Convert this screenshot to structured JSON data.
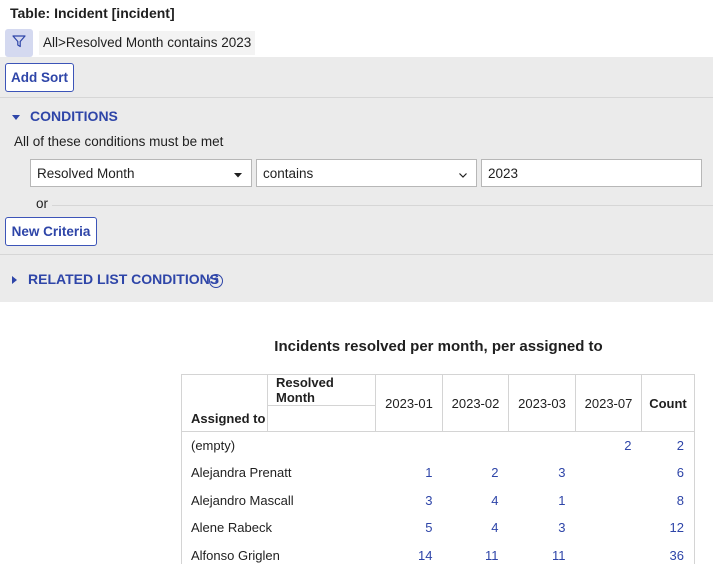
{
  "header": {
    "table_title": "Table: Incident [incident]"
  },
  "filter": {
    "breadcrumb": "All>Resolved Month contains 2023"
  },
  "sort": {
    "add_sort_label": "Add Sort"
  },
  "conditions": {
    "section_label": "CONDITIONS",
    "match_text": "All of these conditions must be met",
    "field": "Resolved Month",
    "operator": "contains",
    "value": "2023",
    "or_label": "or",
    "new_criteria_label": "New Criteria"
  },
  "related": {
    "label": "RELATED LIST CONDITIONS",
    "help_glyph": "?"
  },
  "report": {
    "title": "Incidents resolved per month, per assigned to",
    "column_group_label": "Resolved Month",
    "row_group_label": "Assigned to",
    "columns": [
      "2023-01",
      "2023-02",
      "2023-03",
      "2023-07"
    ],
    "count_label": "Count",
    "rows": [
      {
        "name": "(empty)",
        "cells": [
          "",
          "",
          "",
          "2"
        ],
        "count": "2"
      },
      {
        "name": "Alejandra Prenatt",
        "cells": [
          "1",
          "2",
          "3",
          ""
        ],
        "count": "6"
      },
      {
        "name": "Alejandro Mascall",
        "cells": [
          "3",
          "4",
          "1",
          ""
        ],
        "count": "8"
      },
      {
        "name": "Alene Rabeck",
        "cells": [
          "5",
          "4",
          "3",
          ""
        ],
        "count": "12"
      },
      {
        "name": "Alfonso Griglen",
        "cells": [
          "14",
          "11",
          "11",
          ""
        ],
        "count": "36"
      }
    ]
  },
  "colors": {
    "accent": "#2e45a8",
    "panel_bg": "#ebebeb",
    "filter_btn_bg": "#d4d9f0"
  }
}
